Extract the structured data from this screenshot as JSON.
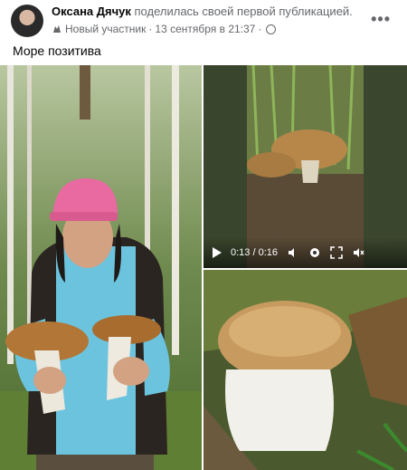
{
  "post": {
    "author_name": "Оксана Дячук",
    "author_action": "поделилась своей первой публикацией.",
    "badge_text": "Новый участник",
    "separator": "·",
    "timestamp": "13 сентября в 21:37",
    "separator2": "·",
    "more_label": "•••",
    "caption": "Море позитива"
  },
  "video": {
    "time": "0:13 / 0:16",
    "progress": 0.81
  },
  "icons": [
    "avatar",
    "badge-icon",
    "globe-icon",
    "more-icon",
    "play-icon",
    "volume-icon",
    "settings-icon",
    "fullscreen-icon",
    "mute-icon"
  ]
}
